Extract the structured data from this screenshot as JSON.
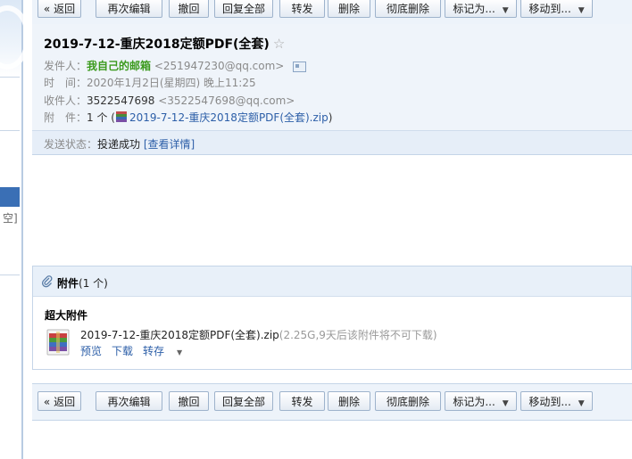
{
  "toolbar": {
    "back": "« 返回",
    "reedit": "再次编辑",
    "recall": "撤回",
    "reply_all": "回复全部",
    "forward": "转发",
    "delete": "删除",
    "delete_forever": "彻底删除",
    "mark_as": "标记为...",
    "move_to": "移动到...",
    "dropdown_arrow": "▼"
  },
  "sidebar": {
    "partial_text": "空]"
  },
  "email": {
    "subject": "2019-7-12-重庆2018定额PDF(全套)",
    "star": "☆",
    "from_label": "发件人：",
    "from_name": "我自己的邮箱",
    "from_addr": "<251947230@qq.com>",
    "time_label": "时　间：",
    "time_value": "2020年1月2日(星期四) 晚上11:25",
    "to_label": "收件人：",
    "to_name": "3522547698",
    "to_addr": "<3522547698@qq.com>",
    "attach_label": "附　件：",
    "attach_count": "1 个 (",
    "attach_file": "2019-7-12-重庆2018定额PDF(全套).zip",
    "attach_close": ")",
    "status_label": "发送状态：",
    "status_value": "投递成功",
    "status_detail": "[查看详情]"
  },
  "attachments": {
    "header_title": "附件",
    "header_count": "(1 个)",
    "section_title": "超大附件",
    "file_name": "2019-7-12-重庆2018定额PDF(全套).zip",
    "file_note": "(2.25G,9天后该附件将不可下载)",
    "preview": "预览",
    "download": "下载",
    "save_to": "转存",
    "dropdown_arrow": "▼"
  },
  "icons": {
    "paperclip": "paperclip-icon",
    "contact_card": "contact-card-icon",
    "zip": "zip-archive-icon",
    "star": "star-icon"
  },
  "colors": {
    "link": "#2d5fa8",
    "sender_name": "#3b9a1d",
    "toolbar_bg": "#edf3fa",
    "header_bg": "#eff4fa"
  }
}
